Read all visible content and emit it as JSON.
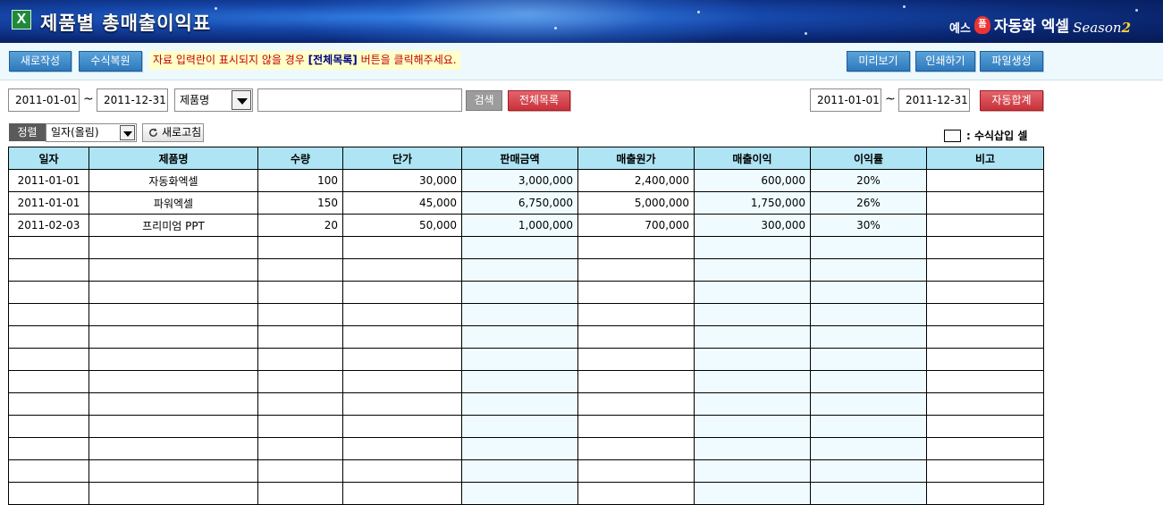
{
  "header": {
    "title": "제품별 총매출이익표",
    "app_icon": "excel-icon",
    "brand_prefix": "예스",
    "brand_badge": "폼",
    "brand_main": "자동화 엑셀",
    "brand_season_text": "Season",
    "brand_season_num": "2"
  },
  "toolbar": {
    "new_label": "새로작성",
    "restore_label": "수식복원",
    "notice_pre": "자료 입력란이 표시되지  않을 경우 ",
    "notice_bold": "[전체목록]",
    "notice_post": " 버튼을 클릭해주세요.",
    "preview_label": "미리보기",
    "print_label": "인쇄하기",
    "export_label": "파일생성"
  },
  "filter": {
    "date_from": "2011-01-01",
    "tilde": "~",
    "date_to": "2011-12-31",
    "field_select": "제품명",
    "search_value": "",
    "search_label": "검색",
    "all_list_label": "전체목록",
    "sum_date_from": "2011-01-01",
    "sum_date_to": "2011-12-31",
    "auto_sum_label": "자동합계"
  },
  "sort": {
    "label": "정렬",
    "selected": "일자(올림)",
    "refresh_label": "새로고침"
  },
  "legend": {
    "label": ": 수식삽입 셀"
  },
  "table": {
    "columns": [
      "일자",
      "제품명",
      "수량",
      "단가",
      "판매금액",
      "매출원가",
      "매출이익",
      "이익률",
      "비고"
    ],
    "rows": [
      [
        "2011-01-01",
        "자동화엑셀",
        "100",
        "30,000",
        "3,000,000",
        "2,400,000",
        "600,000",
        "20%",
        ""
      ],
      [
        "2011-01-01",
        "파워엑셀",
        "150",
        "45,000",
        "6,750,000",
        "5,000,000",
        "1,750,000",
        "26%",
        ""
      ],
      [
        "2011-02-03",
        "프리미엄 PPT",
        "20",
        "50,000",
        "1,000,000",
        "700,000",
        "300,000",
        "30%",
        ""
      ]
    ],
    "empty_rows": 12
  },
  "colors": {
    "header_bg": "#aee4f4",
    "formula_cell_bg": "#effbfe",
    "blue_button": "#2f79bd",
    "red_button": "#c8323b",
    "notice_text": "#c00000"
  }
}
